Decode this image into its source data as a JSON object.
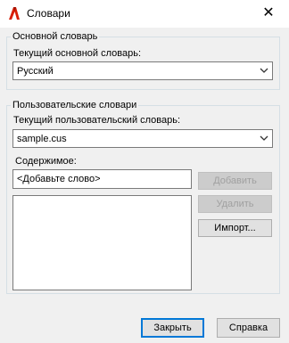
{
  "window": {
    "title": "Словари",
    "close_glyph": "✕"
  },
  "main_group": {
    "legend": "Основной словарь",
    "label": "Текущий основной словарь:",
    "selected": "Русский"
  },
  "custom_group": {
    "legend": "Пользовательские словари",
    "label": "Текущий пользовательский словарь:",
    "selected": "sample.cus",
    "contents_label": "Содержимое:",
    "word_input_value": "<Добавьте слово>",
    "add_label": "Добавить",
    "delete_label": "Удалить",
    "import_label": "Импорт..."
  },
  "footer": {
    "close_label": "Закрыть",
    "help_label": "Справка"
  },
  "colors": {
    "app_icon_red": "#d81e05",
    "default_button_border": "#0078d7"
  }
}
